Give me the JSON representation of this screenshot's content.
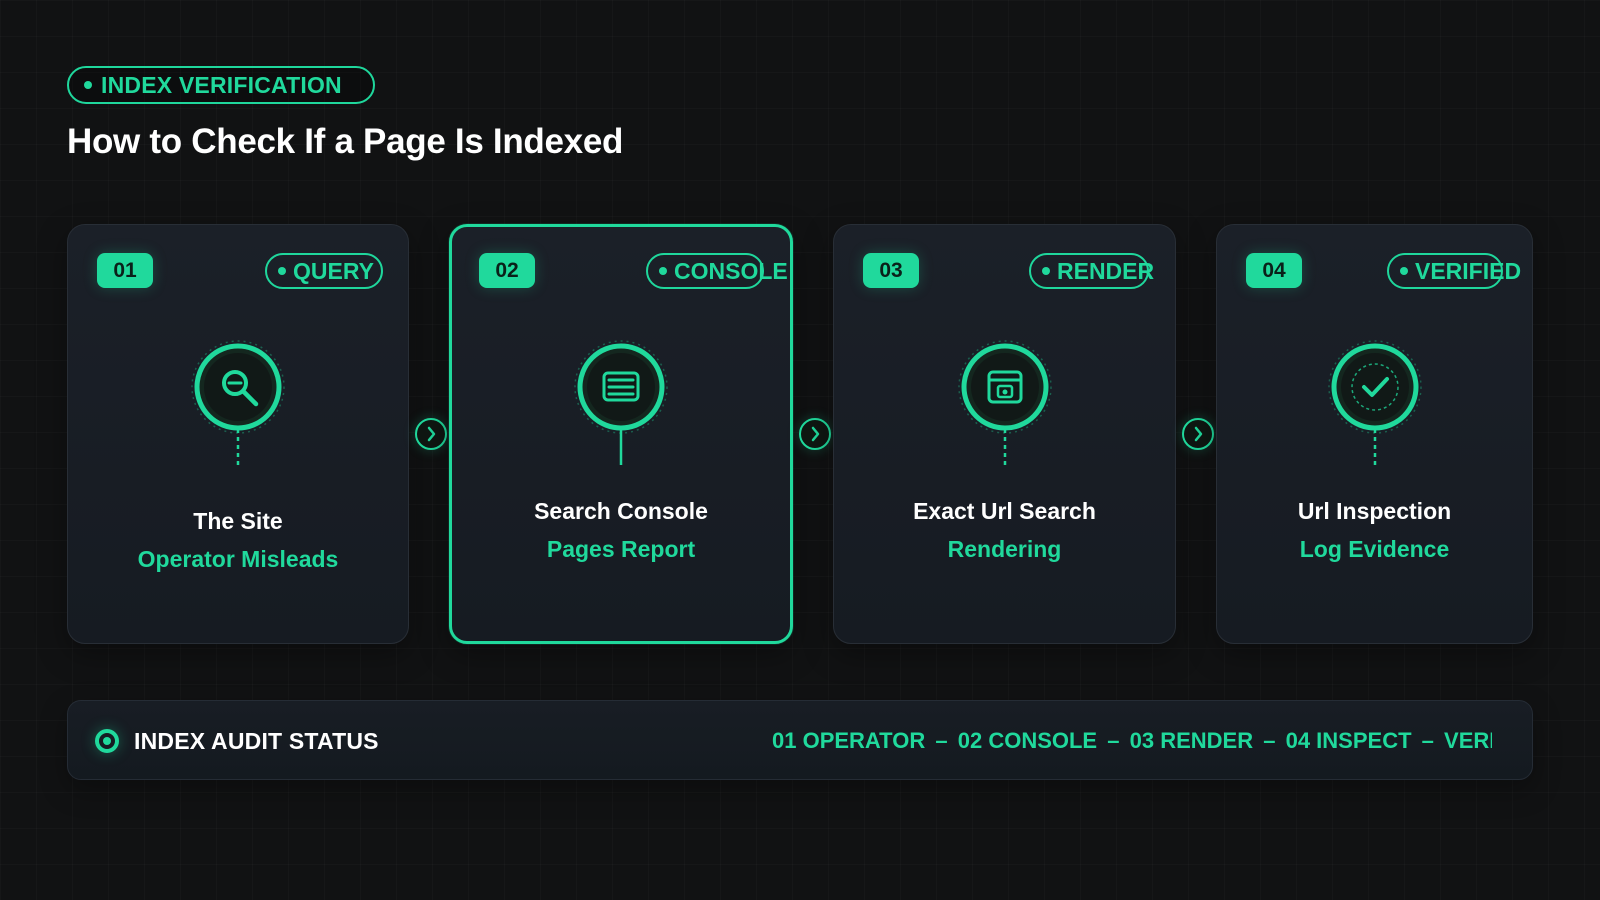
{
  "header": {
    "eyebrow": "INDEX VERIFICATION",
    "title": "How to Check If a Page Is Indexed"
  },
  "colors": {
    "background": "#111213",
    "accent": "#20d99c",
    "card": "#1a1f27",
    "text": "#ffffff"
  },
  "steps": [
    {
      "number": "01",
      "tag": "QUERY",
      "title": "The Site",
      "subtitle": "Operator Misleads",
      "icon": "magnifier-icon"
    },
    {
      "number": "02",
      "tag": "CONSOLE",
      "title": "Search Console",
      "subtitle": "Pages Report",
      "icon": "console-icon"
    },
    {
      "number": "03",
      "tag": "RENDER",
      "title": "Exact Url Search",
      "subtitle": "Rendering",
      "icon": "render-window-icon"
    },
    {
      "number": "04",
      "tag": "VERIFIED",
      "title": "Url Inspection",
      "subtitle": "Log Evidence",
      "icon": "checkmark-icon"
    }
  ],
  "status": {
    "label": "INDEX AUDIT STATUS",
    "sequence": [
      "01 OPERATOR",
      "02 CONSOLE",
      "03 RENDER",
      "04 INSPECT",
      "VERIFIED"
    ]
  }
}
